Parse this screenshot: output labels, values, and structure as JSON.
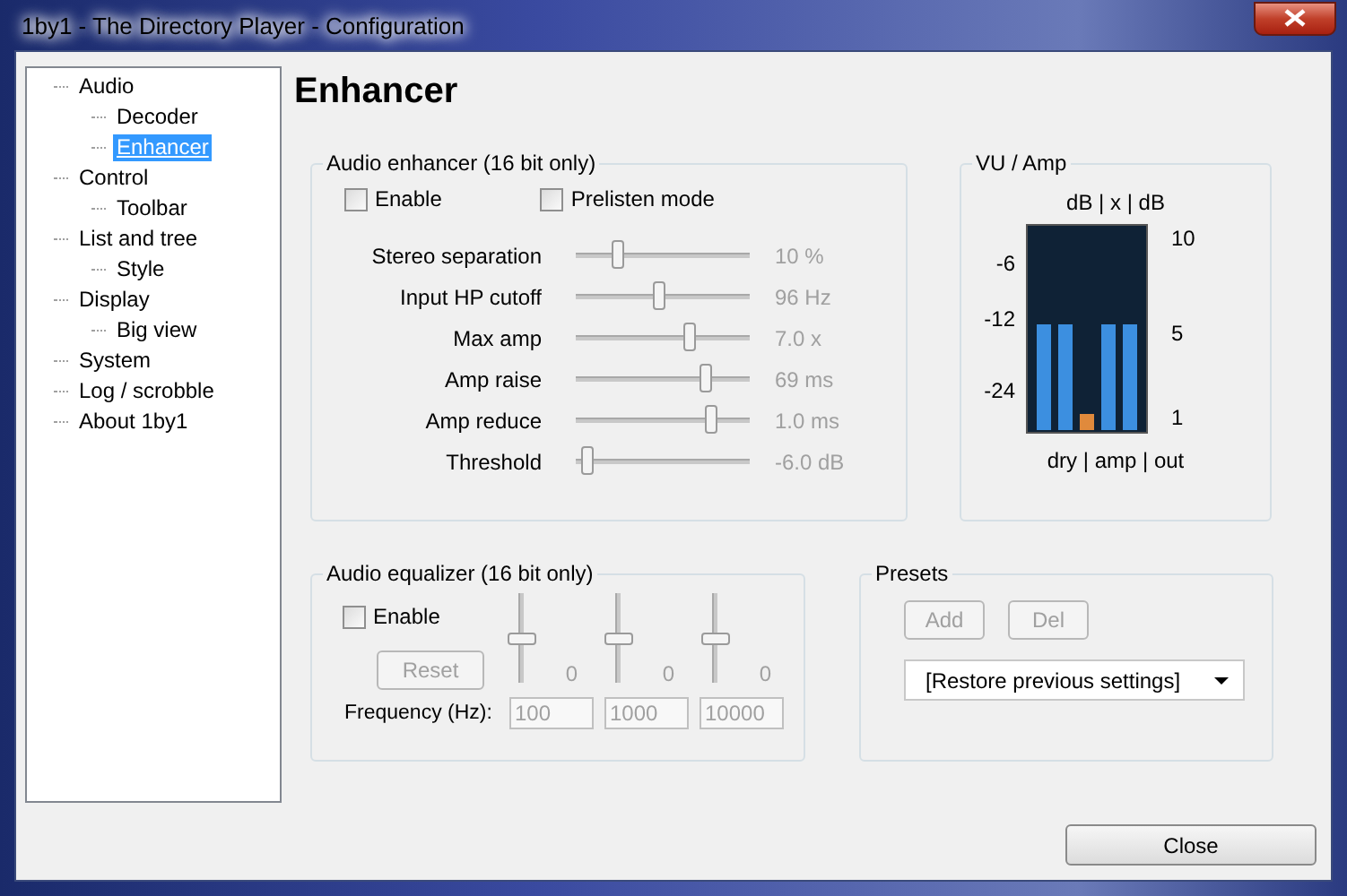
{
  "window": {
    "title": "1by1 - The Directory Player - Configuration"
  },
  "tree": [
    {
      "label": "Audio",
      "selected": false,
      "children": [
        {
          "label": "Decoder",
          "selected": false
        },
        {
          "label": "Enhancer",
          "selected": true
        }
      ]
    },
    {
      "label": "Control",
      "selected": false,
      "children": [
        {
          "label": "Toolbar",
          "selected": false
        }
      ]
    },
    {
      "label": "List and tree",
      "selected": false,
      "children": [
        {
          "label": "Style",
          "selected": false
        }
      ]
    },
    {
      "label": "Display",
      "selected": false,
      "children": [
        {
          "label": "Big view",
          "selected": false
        }
      ]
    },
    {
      "label": "System",
      "selected": false
    },
    {
      "label": "Log / scrobble",
      "selected": false
    },
    {
      "label": "About 1by1",
      "selected": false
    }
  ],
  "heading": "Enhancer",
  "enhancer": {
    "title": "Audio enhancer (16 bit only)",
    "options": [
      {
        "label": "Enable",
        "checked": false
      },
      {
        "label": "Prelisten mode",
        "checked": false
      }
    ],
    "sliders": [
      {
        "label": "Stereo separation",
        "level": 0.22,
        "reading": "10 %",
        "disabled": true
      },
      {
        "label": "Input HP cutoff",
        "level": 0.48,
        "reading": "96 Hz",
        "disabled": true
      },
      {
        "label": "Max amp",
        "level": 0.67,
        "reading": "7.0 x",
        "disabled": true
      },
      {
        "label": "Amp raise",
        "level": 0.77,
        "reading": "69 ms",
        "disabled": true
      },
      {
        "label": "Amp reduce",
        "level": 0.8,
        "reading": "1.0 ms",
        "disabled": true
      },
      {
        "label": "Threshold",
        "level": 0.03,
        "reading": "-6.0 dB",
        "disabled": true
      }
    ]
  },
  "vu": {
    "title": "VU / Amp",
    "header": "dB | x | dB",
    "left_scale": [
      "-6",
      "-12",
      "-24"
    ],
    "right_scale": [
      "10",
      "5",
      "1"
    ],
    "footer": "dry | amp | out",
    "bars": [
      {
        "level": 0.52,
        "color": "#3c8fe0"
      },
      {
        "level": 0.52,
        "color": "#3c8fe0"
      },
      {
        "level": 0.08,
        "color": "#e08a3c"
      },
      {
        "level": 0.52,
        "color": "#3c8fe0"
      },
      {
        "level": 0.52,
        "color": "#3c8fe0"
      }
    ]
  },
  "equalizer": {
    "title": "Audio equalizer (16 bit only)",
    "enable": {
      "label": "Enable",
      "checked": false
    },
    "reset": {
      "label": "Reset",
      "disabled": true
    },
    "frequency_label": "Frequency (Hz):",
    "bands": [
      {
        "level": 0.5,
        "reading": "0",
        "frequency": "100"
      },
      {
        "level": 0.5,
        "reading": "0",
        "frequency": "1000"
      },
      {
        "level": 0.5,
        "reading": "0",
        "frequency": "10000"
      }
    ]
  },
  "presets": {
    "title": "Presets",
    "buttons": [
      {
        "label": "Add",
        "disabled": true
      },
      {
        "label": "Del",
        "disabled": true
      }
    ],
    "dropdown": "[Restore previous settings]"
  },
  "close_button": {
    "label": "Close"
  }
}
